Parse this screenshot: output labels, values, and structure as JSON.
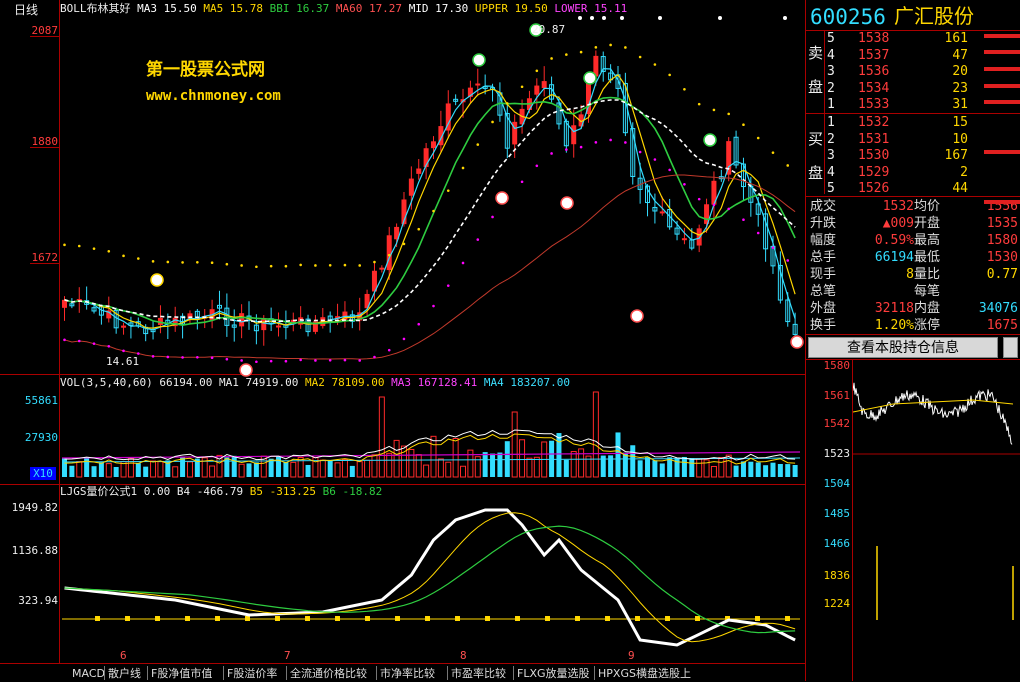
{
  "period_label": "日线",
  "price_panel": {
    "legend": [
      {
        "text": "BOLL布林其好",
        "color": "#eeeeee"
      },
      {
        "text": "MA3 15.50",
        "color": "#ffffff"
      },
      {
        "text": "MA5 15.78",
        "color": "#ffd700"
      },
      {
        "text": "BBI 16.37",
        "color": "#2ecc40"
      },
      {
        "text": "MA60 17.27",
        "color": "#ff5050"
      },
      {
        "text": "MID 17.30",
        "color": "#ffffff"
      },
      {
        "text": "UPPER 19.50",
        "color": "#ffd700"
      },
      {
        "text": "LOWER 15.11",
        "color": "#ff44ff"
      }
    ],
    "y_labels": [
      "2087",
      "1880",
      "1672"
    ],
    "watermark_title": "第一股票公式网",
    "watermark_url": "www.chnmoney.com",
    "high_marker": "20.87",
    "low_marker": "14.61"
  },
  "volume_panel": {
    "legend": [
      {
        "text": "VOL(3,5,40,60)",
        "color": "#eeeeee"
      },
      {
        "text": "66194.00",
        "color": "#eeeeee"
      },
      {
        "text": "MA1 74919.00",
        "color": "#eeeeee"
      },
      {
        "text": "MA2 78109.00",
        "color": "#ffd700"
      },
      {
        "text": "MA3 167128.41",
        "color": "#ff44ff"
      },
      {
        "text": "MA4 183207.00",
        "color": "#3ddfff"
      }
    ],
    "y_labels": [
      "55861",
      "27930"
    ],
    "unit": "X10"
  },
  "indicator_panel": {
    "legend": [
      {
        "text": "LJGS量价公式1",
        "color": "#eeeeee"
      },
      {
        "text": "0.00",
        "color": "#eeeeee"
      },
      {
        "text": "B4 -466.79",
        "color": "#eeeeee"
      },
      {
        "text": "B5 -313.25",
        "color": "#ffd700"
      },
      {
        "text": "B6 -18.82",
        "color": "#2ecc40"
      }
    ],
    "y_labels": [
      "1949.82",
      "1136.88",
      "323.94"
    ]
  },
  "x_axis_months": [
    "6",
    "7",
    "8",
    "9"
  ],
  "tabs": [
    "MACD",
    "散户线",
    "F股净值市值",
    "F股溢价率",
    "全流通价格比较",
    "市净率比较",
    "市盈率比较",
    "FLXG放量选股",
    "HPXGS横盘选股上"
  ],
  "quote": {
    "code": "600256",
    "name": "广汇股份",
    "sell_label": [
      "卖",
      "盘"
    ],
    "buy_label": [
      "买",
      "盘"
    ],
    "asks": [
      {
        "level": "5",
        "price": "1538",
        "vol": "161"
      },
      {
        "level": "4",
        "price": "1537",
        "vol": "47"
      },
      {
        "level": "3",
        "price": "1536",
        "vol": "20"
      },
      {
        "level": "2",
        "price": "1534",
        "vol": "23"
      },
      {
        "level": "1",
        "price": "1533",
        "vol": "31"
      }
    ],
    "bids": [
      {
        "level": "1",
        "price": "1532",
        "vol": "15"
      },
      {
        "level": "2",
        "price": "1531",
        "vol": "10"
      },
      {
        "level": "3",
        "price": "1530",
        "vol": "167"
      },
      {
        "level": "4",
        "price": "1529",
        "vol": "2"
      },
      {
        "level": "5",
        "price": "1526",
        "vol": "44"
      }
    ],
    "stats": [
      {
        "l1": "成交",
        "v1": "1532",
        "l2": "均价",
        "v2": "1556"
      },
      {
        "l1": "升跌",
        "v1": "▲009",
        "l2": "开盘",
        "v2": "1535"
      },
      {
        "l1": "幅度",
        "v1": "0.59%",
        "l2": "最高",
        "v2": "1580"
      },
      {
        "l1": "总手",
        "v1": "66194",
        "l2": "最低",
        "v2": "1530"
      },
      {
        "l1": "现手",
        "v1": "8",
        "l2": "量比",
        "v2": "0.77"
      },
      {
        "l1": "总笔",
        "v1": "",
        "l2": "每笔",
        "v2": ""
      },
      {
        "l1": "外盘",
        "v1": "32118",
        "l2": "内盘",
        "v2": "34076"
      },
      {
        "l1": "换手",
        "v1": "1.20%",
        "l2": "涨停",
        "v2": "1675"
      }
    ],
    "holdings_button": "查看本股持仓信息"
  },
  "intraday": {
    "price_labels": [
      "1580",
      "1561",
      "1542",
      "1523",
      "1504",
      "1485",
      "1466"
    ],
    "vol_labels": [
      "1836",
      "1224"
    ]
  }
}
